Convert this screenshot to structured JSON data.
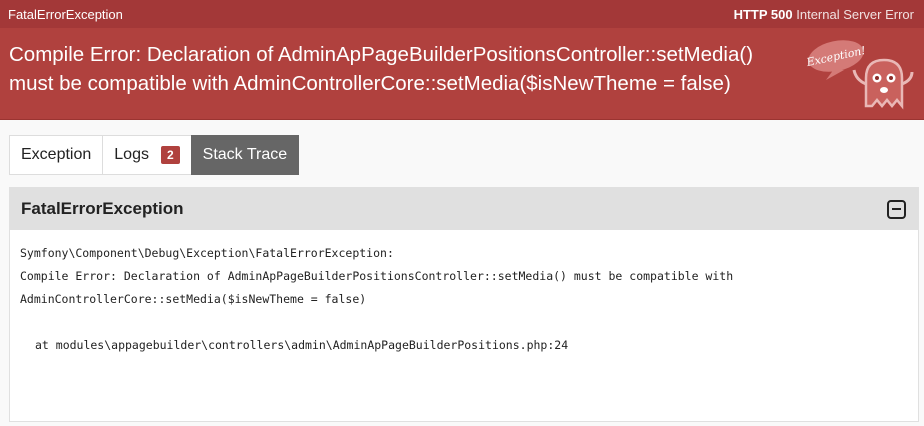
{
  "topbar": {
    "exception_name": "FatalErrorException",
    "http_code": "HTTP 500",
    "http_text": "Internal Server Error"
  },
  "header": {
    "title_line1": "Compile Error: Declaration of AdminApPageBuilderPositionsController::setMedia()",
    "title_line2": "must be compatible with AdminControllerCore::setMedia($isNewTheme = false)",
    "mascot_text": "Exception!"
  },
  "tabs": [
    {
      "label": "Exception"
    },
    {
      "label": "Logs",
      "badge": "2"
    },
    {
      "label": "Stack Trace",
      "active": true
    }
  ],
  "panel": {
    "title": "FatalErrorException",
    "lines": [
      "Symfony\\Component\\Debug\\Exception\\FatalErrorException:",
      "Compile Error: Declaration of AdminApPageBuilderPositionsController::setMedia() must be compatible with",
      "AdminControllerCore::setMedia($isNewTheme = false)"
    ],
    "location": "at modules\\appagebuilder\\controllers\\admin\\AdminApPageBuilderPositions.php:24"
  },
  "colors": {
    "topbar": "#a33838",
    "header": "#b0413e",
    "active_tab": "#666666"
  }
}
